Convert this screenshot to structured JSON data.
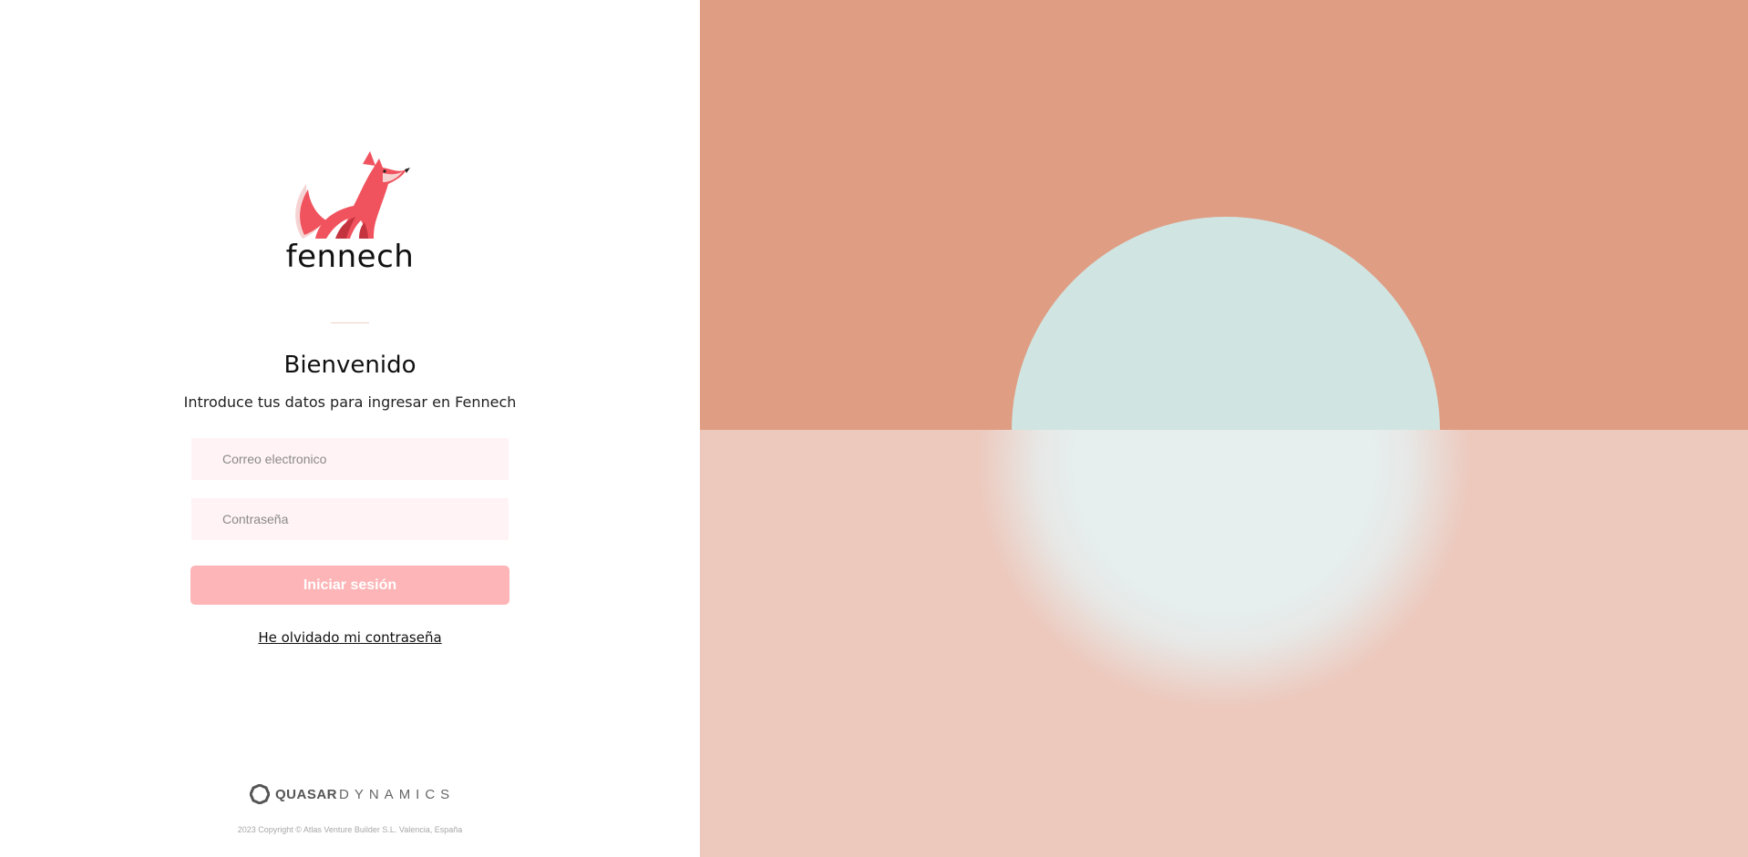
{
  "brand": {
    "name": "fennech",
    "logo_icon": "fox-icon",
    "colors": {
      "primary": "#f0535e",
      "accent": "#fdb5b7"
    }
  },
  "login": {
    "title": "Bienvenido",
    "subtitle": "Introduce tus datos para ingresar en Fennech",
    "email_placeholder": "Correo electronico",
    "email_value": "",
    "password_placeholder": "Contraseña",
    "password_value": "",
    "submit_label": "Iniciar sesión",
    "forgot_label": "He olvidado mi contraseña"
  },
  "footer": {
    "company_bold": "QUASAR",
    "company_light": "DYNAMICS",
    "copyright": "2023 Copyright © Atlas Venture Builder S.L. Valencia, España"
  },
  "illustration": {
    "sky_color": "#df9d83",
    "sun_color": "#d0e4e2",
    "water_color": "#edc8bc"
  }
}
